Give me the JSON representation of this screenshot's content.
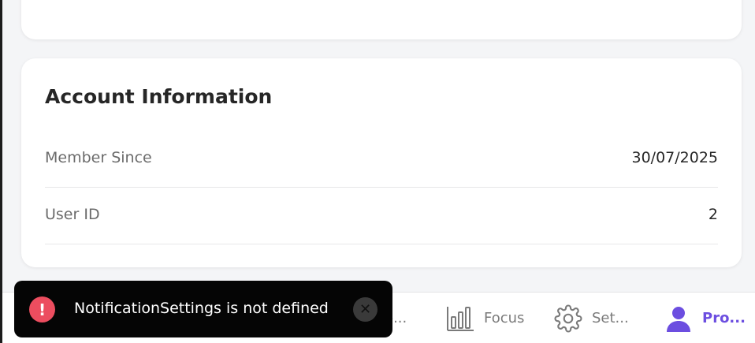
{
  "account": {
    "title": "Account Information",
    "rows": [
      {
        "label": "Member Since",
        "value": "30/07/2025"
      },
      {
        "label": "User ID",
        "value": "2"
      }
    ]
  },
  "bottom_nav": {
    "items": [
      {
        "label": "re...",
        "icon": "partial-icon"
      },
      {
        "label": "Focus",
        "icon": "bar-chart-icon"
      },
      {
        "label": "Set...",
        "icon": "gear-icon"
      },
      {
        "label": "Pro...",
        "icon": "user-icon",
        "active": true
      }
    ]
  },
  "toast": {
    "message": "NotificationSettings is not defined",
    "icon": "error-icon",
    "icon_text": "!",
    "close_symbol": "✕"
  },
  "colors": {
    "accent": "#6c4ee0",
    "error": "#ec4d5f",
    "toast_bg": "#050505"
  }
}
